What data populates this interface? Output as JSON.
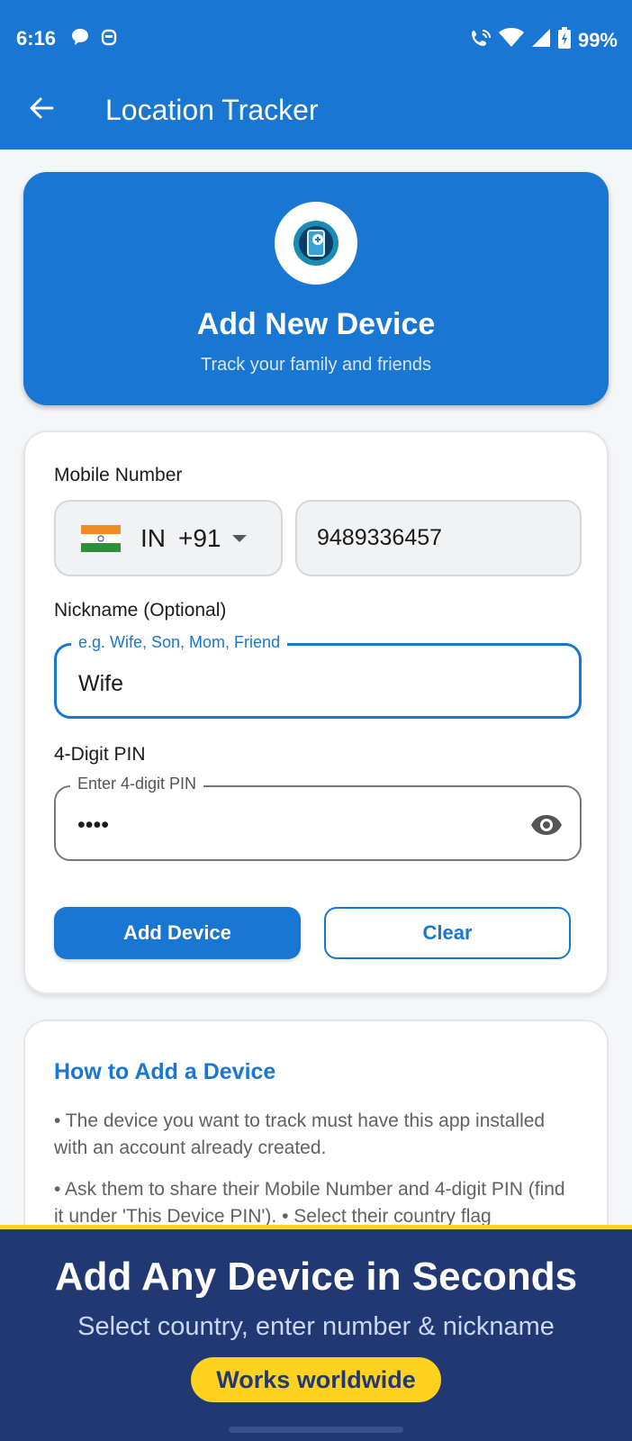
{
  "status_bar": {
    "time": "6:16",
    "battery": "99%",
    "icons": [
      "chat-bubble-icon",
      "robot-icon",
      "wifi-calling-icon",
      "wifi-icon",
      "signal-icon",
      "battery-charging-icon"
    ]
  },
  "app_bar": {
    "title": "Location Tracker",
    "back_icon": "arrow-left-icon",
    "background": "#1976d2"
  },
  "hero": {
    "icon": "phone-location-icon",
    "title": "Add New Device",
    "subtitle": "Track your family and friends"
  },
  "form": {
    "mobile_label": "Mobile Number",
    "country_code": "IN",
    "dial_code": "+91",
    "country_flag": "india-flag-icon",
    "phone_value": "9489336457",
    "nickname_label": "Nickname (Optional)",
    "nickname_hint": "e.g. Wife, Son, Mom, Friend",
    "nickname_value": "Wife",
    "pin_label": "4-Digit PIN",
    "pin_hint": "Enter 4-digit PIN",
    "pin_value": "1234",
    "add_button": "Add Device",
    "clear_button": "Clear"
  },
  "howto": {
    "title": "How to Add a Device",
    "step1": "• The device you want to track must have this app installed with an account already created.",
    "step2": "• Ask them to share their Mobile Number and 4-digit PIN (find it under 'This Device PIN').  • Select their country flag"
  },
  "promo_banner": {
    "title": "Add Any Device in Seconds",
    "subtitle": "Select country, enter number & nickname",
    "badge": "Works worldwide"
  },
  "colors": {
    "primary": "#1976d2",
    "banner": "#213873",
    "accent": "#ffd21f"
  }
}
